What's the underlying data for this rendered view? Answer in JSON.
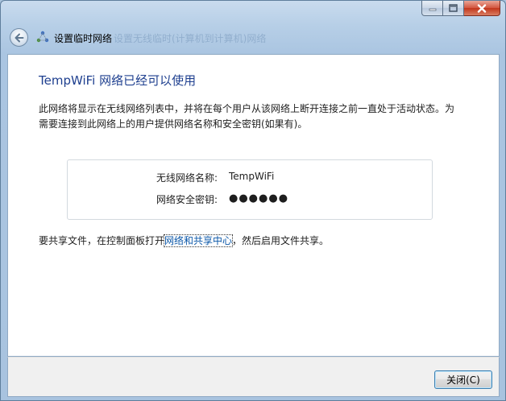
{
  "header": {
    "title": "设置临时网络",
    "ghost_title": "设置无线临时(计算机到计算机)网络"
  },
  "content": {
    "heading": "TempWiFi 网络已经可以使用",
    "description": "此网络将显示在无线网络列表中，并将在每个用户从该网络上断开连接之前一直处于活动状态。为需要连接到此网络上的用户提供网络名称和安全密钥(如果有)。",
    "network_name_label": "无线网络名称:",
    "network_name_value": "TempWiFi",
    "security_key_label": "网络安全密钥:",
    "security_key_value": "●●●●●●",
    "share_prefix": "要共享文件，在控制面板打开",
    "share_link": "网络和共享中心",
    "share_suffix": "，然后启用文件共享。"
  },
  "footer": {
    "close_label": "关闭(C)"
  },
  "icons": {
    "back": "back-arrow-icon",
    "wizard": "adhoc-network-icon",
    "minimize": "minimize-icon",
    "maximize": "maximize-icon",
    "close": "close-icon"
  },
  "colors": {
    "heading": "#1e3f8f",
    "link": "#0b57a8",
    "frame": "#a9c3dc"
  }
}
